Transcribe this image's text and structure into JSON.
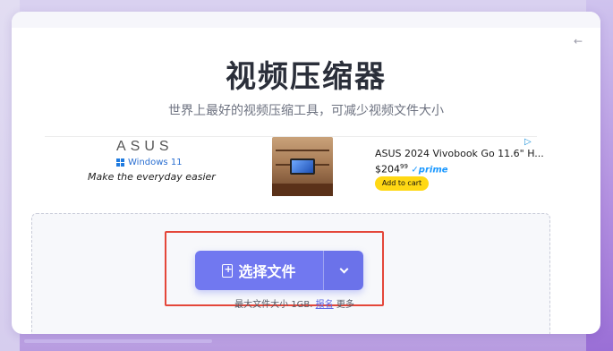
{
  "nav": {
    "back_icon": "arrow-left-icon",
    "back_glyph": "←"
  },
  "page": {
    "title": "视频压缩器",
    "subtitle": "世界上最好的视频压缩工具，可减少视频文件大小"
  },
  "ad": {
    "brand": "ASUS",
    "windows_label": "Windows 11",
    "tagline": "Make the everyday easier",
    "product_title": "ASUS 2024 Vivobook Go 11.6\" H...",
    "price_symbol": "$",
    "price_whole": "204",
    "price_cents": "99",
    "prime_label": "✓prime",
    "cart_label": "Add to cart",
    "adchoices_icon": "adchoices-icon",
    "adchoices_glyph": "▷"
  },
  "upload": {
    "button_label": "选择文件",
    "button_icon": "file-add-icon",
    "dropdown_icon": "chevron-down-icon",
    "limit_prefix": "最大文件大小 1GB.",
    "signup_link": "报名",
    "limit_suffix": "更多"
  },
  "colors": {
    "accent": "#7178f0",
    "highlight": "#e4473a",
    "cart": "#ffd814"
  }
}
